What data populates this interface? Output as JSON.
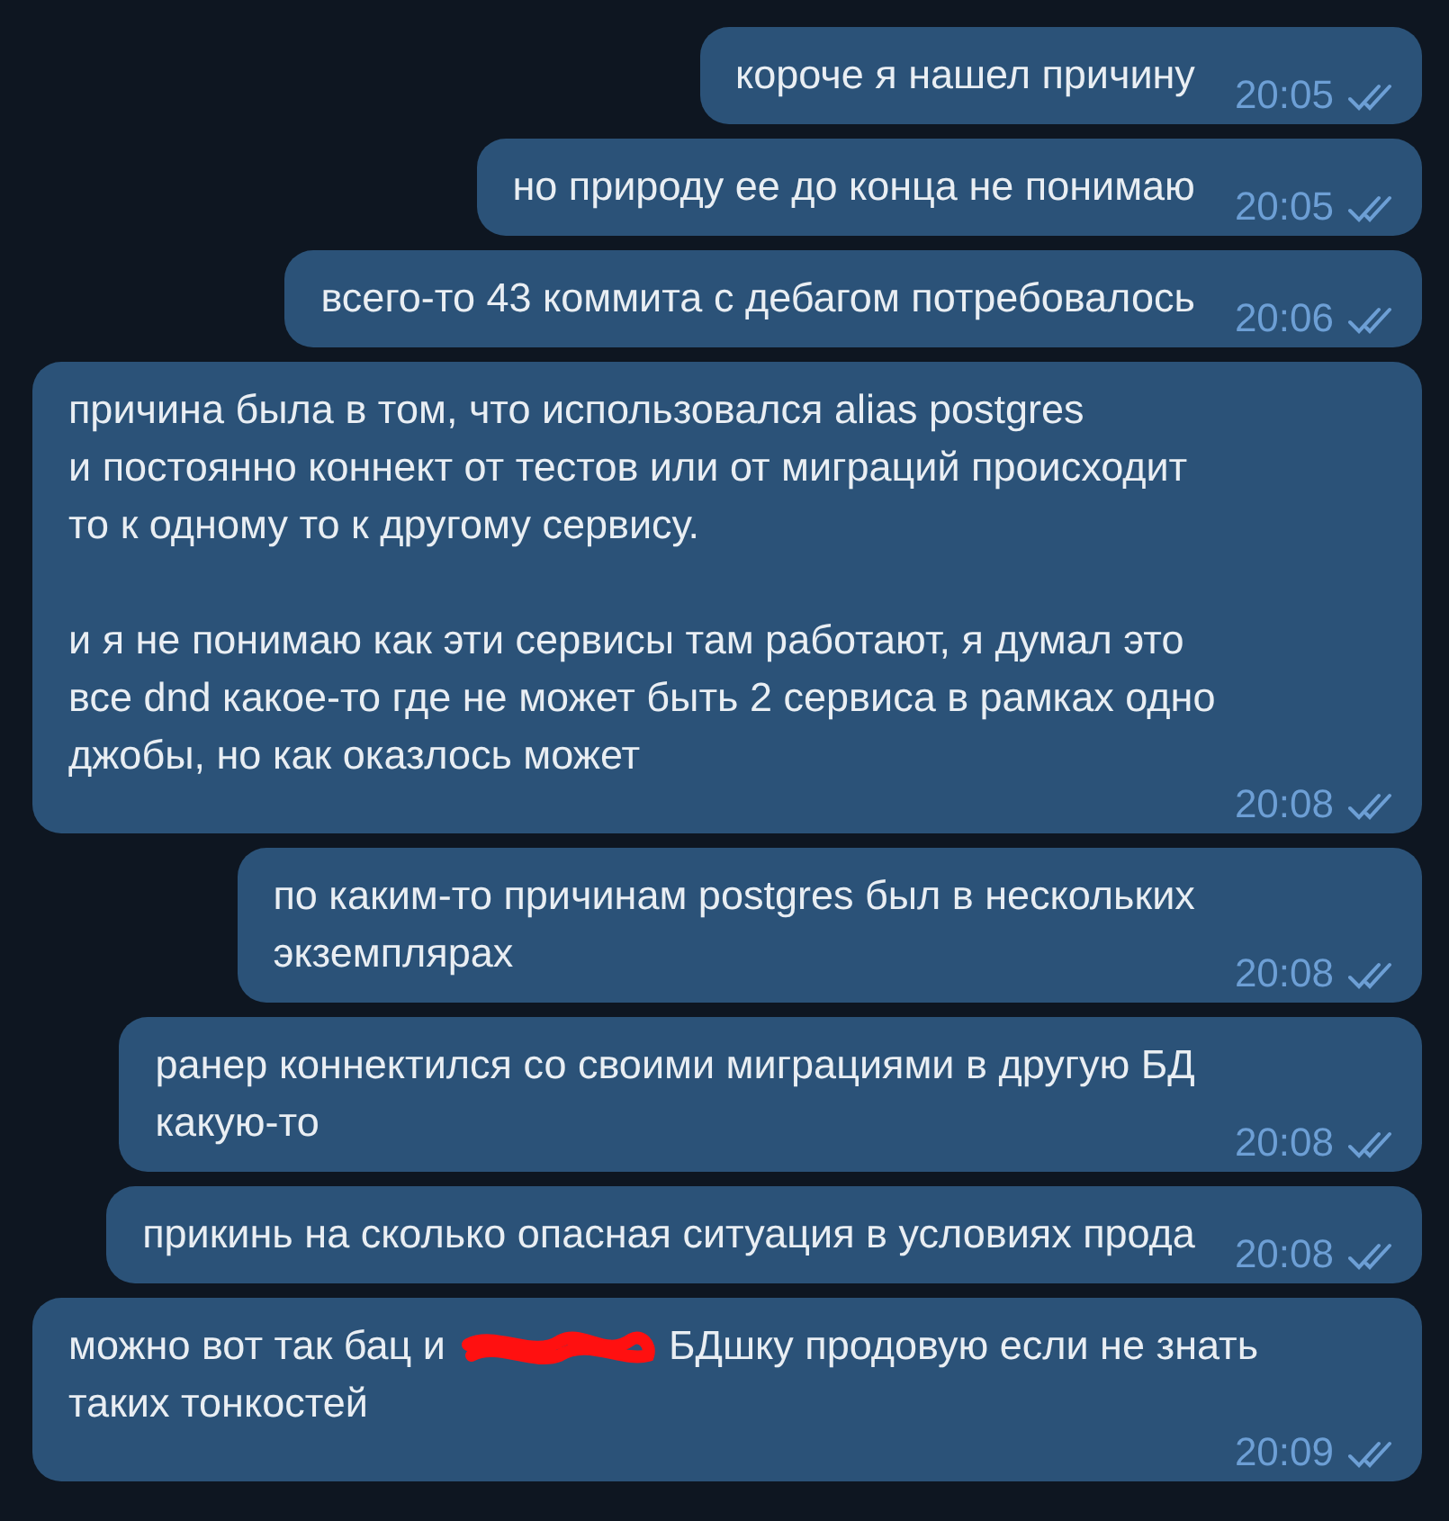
{
  "messages": [
    {
      "parts": [
        {
          "kind": "text",
          "text": "короче я нашел причину"
        }
      ],
      "time": "20:05",
      "read": true
    },
    {
      "parts": [
        {
          "kind": "text",
          "text": "но природу ее до конца не понимаю"
        }
      ],
      "time": "20:05",
      "read": true
    },
    {
      "parts": [
        {
          "kind": "text",
          "text": "всего-то 43 коммита с дебагом потребовалось"
        }
      ],
      "time": "20:06",
      "read": true
    },
    {
      "parts": [
        {
          "kind": "text",
          "text": "причина была в том, что использовался alias postgres\nи постоянно коннект от тестов или от миграций происходит\nто к одному то к другому сервису.\n\nи я не понимаю как эти сервисы там работают, я думал это\nвсе dnd какое-то где не может быть 2 сервиса в рамках одно\nджобы, но как оказлось может"
        }
      ],
      "time": "20:08",
      "read": true
    },
    {
      "parts": [
        {
          "kind": "text",
          "text": "по каким-то причинам postgres был в нескольких\nэкземплярах"
        }
      ],
      "time": "20:08",
      "read": true
    },
    {
      "parts": [
        {
          "kind": "text",
          "text": "ранер коннектился со своими миграциями в другую БД\nкакую-то"
        }
      ],
      "time": "20:08",
      "read": true
    },
    {
      "parts": [
        {
          "kind": "text",
          "text": "прикинь на сколько опасная ситуация в условиях прода"
        }
      ],
      "time": "20:08",
      "read": true
    },
    {
      "parts": [
        {
          "kind": "text",
          "text": "можно вот так бац и"
        },
        {
          "kind": "redaction"
        },
        {
          "kind": "text",
          "text": "БДшку продовую если не знать"
        },
        {
          "kind": "break"
        },
        {
          "kind": "text",
          "text": "таких тонкостей"
        }
      ],
      "time": "20:09",
      "read": true
    }
  ]
}
